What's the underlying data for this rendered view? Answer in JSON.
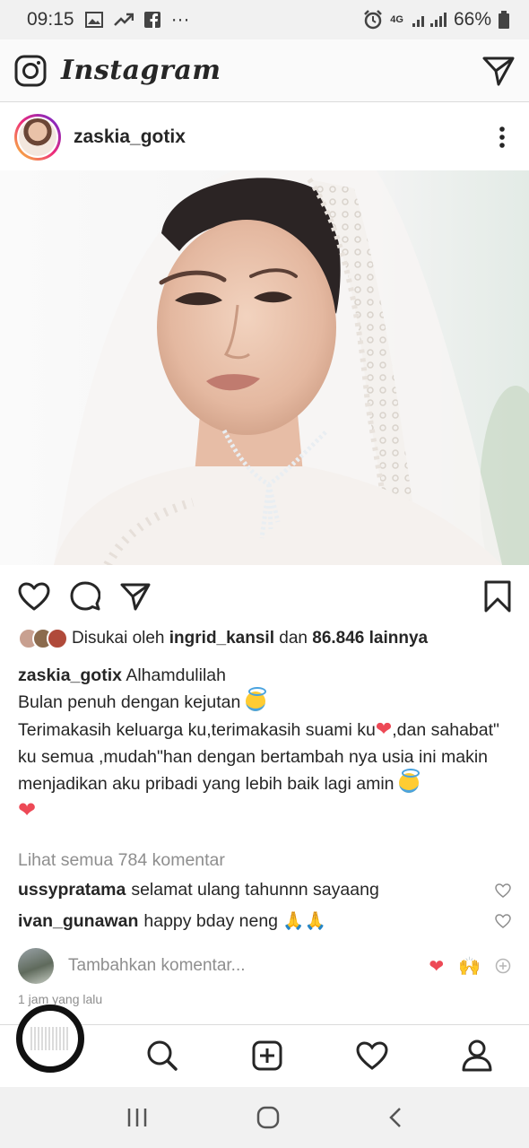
{
  "status_bar": {
    "time": "09:15",
    "more": "···",
    "network": "4G",
    "battery": "66%"
  },
  "app": {
    "title": "Instagram"
  },
  "post": {
    "username": "zaskia_gotix",
    "likes": {
      "prefix": "Disukai oleh",
      "liker": "ingrid_kansil",
      "joiner": "dan",
      "others": "86.846 lainnya"
    },
    "caption": {
      "username": "zaskia_gotix",
      "line1": "Alhamdulilah",
      "line2": "Bulan penuh dengan kejutan",
      "line3a": "Terimakasih keluarga ku,terimakasih suami ku",
      "line3b": ",dan sahabat\" ku semua ,mudah\"han dengan bertambah nya usia  ini makin menjadikan aku pribadi yang lebih baik lagi amin"
    },
    "view_comments": "Lihat semua 784 komentar",
    "comments": [
      {
        "username": "ussypratama",
        "text": "selamat  ulang tahunnn sayaang"
      },
      {
        "username": "ivan_gunawan",
        "text": "happy bday neng 🙏🙏"
      }
    ],
    "add_comment_placeholder": "Tambahkan komentar...",
    "quick_reactions": [
      "❤",
      "🙌"
    ],
    "timestamp": "1 jam yang lalu"
  },
  "colors": {
    "heart_red": "#ed4956",
    "muted_text": "#8e8e8e",
    "text": "#262626"
  }
}
